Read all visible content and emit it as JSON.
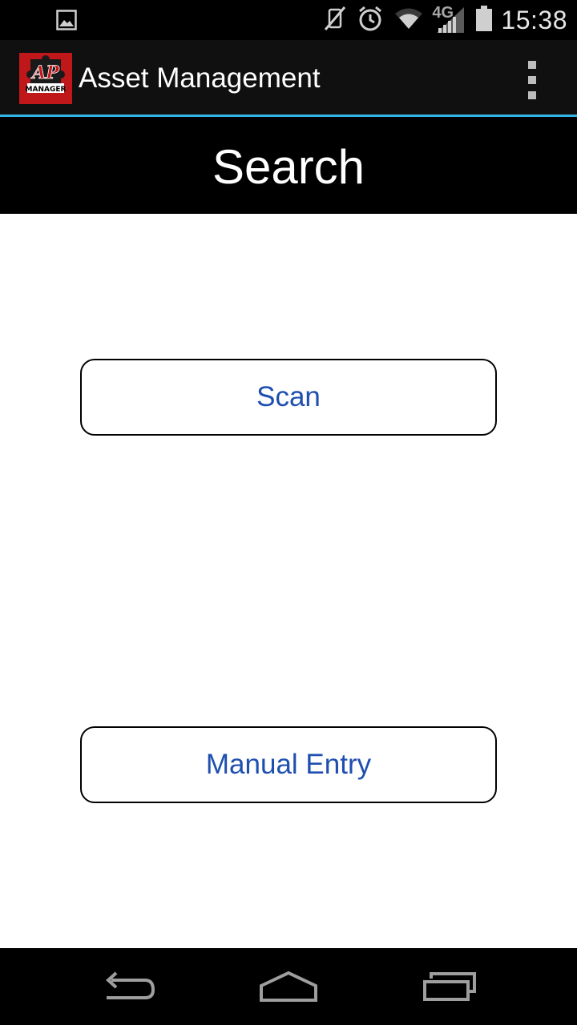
{
  "status_bar": {
    "time": "15:38",
    "network_label": "4G",
    "icons": [
      "gallery-icon",
      "vibrate-mute-icon",
      "alarm-icon",
      "wifi-icon",
      "lte-signal-icon",
      "battery-icon"
    ]
  },
  "action_bar": {
    "app_icon": "ap-manager-logo",
    "app_icon_text": "AP MANAGER",
    "title": "Asset Management",
    "overflow_icon": "overflow-menu-icon"
  },
  "page": {
    "title": "Search"
  },
  "buttons": {
    "scan_label": "Scan",
    "manual_entry_label": "Manual Entry"
  },
  "nav_bar": {
    "icons": [
      "back-icon",
      "home-icon",
      "recents-icon"
    ]
  },
  "colors": {
    "accent_line": "#33b5e5",
    "button_text": "#1e4fb0",
    "action_bar_bg": "#101010",
    "logo_red": "#c0171b"
  }
}
